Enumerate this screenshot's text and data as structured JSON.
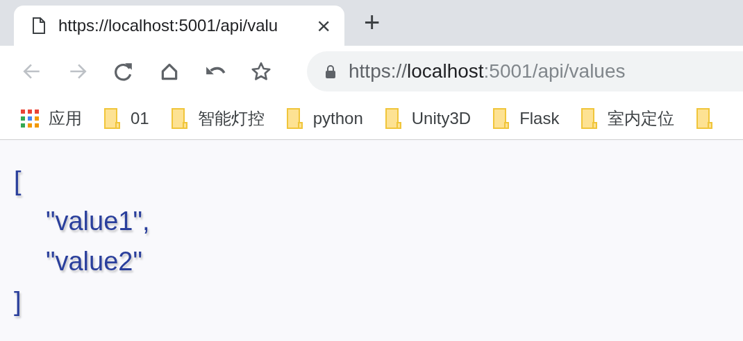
{
  "tab": {
    "title": "https://localhost:5001/api/valu",
    "close": "×",
    "new_tab": "+"
  },
  "toolbar": {
    "buttons": [
      {
        "kind": "back",
        "disabled": true
      },
      {
        "kind": "forward",
        "disabled": true
      },
      {
        "kind": "reload",
        "disabled": false
      },
      {
        "kind": "home",
        "disabled": false
      },
      {
        "kind": "undo",
        "disabled": false
      },
      {
        "kind": "star",
        "disabled": false
      }
    ]
  },
  "address": {
    "scheme": "https://",
    "host": "localhost",
    "rest": ":5001/api/values"
  },
  "bookmarks": [
    {
      "kind": "apps",
      "label": "应用"
    },
    {
      "kind": "folder",
      "label": "01"
    },
    {
      "kind": "folder",
      "label": "智能灯控"
    },
    {
      "kind": "folder",
      "label": "python"
    },
    {
      "kind": "folder",
      "label": "Unity3D"
    },
    {
      "kind": "folder",
      "label": "Flask"
    },
    {
      "kind": "folder",
      "label": "室内定位"
    },
    {
      "kind": "folder"
    }
  ],
  "content": {
    "lines": [
      {
        "text": "[",
        "indent": false
      },
      {
        "text": "\"value1\",",
        "indent": true
      },
      {
        "text": "\"value2\"",
        "indent": true
      },
      {
        "text": "]",
        "indent": false
      }
    ]
  }
}
